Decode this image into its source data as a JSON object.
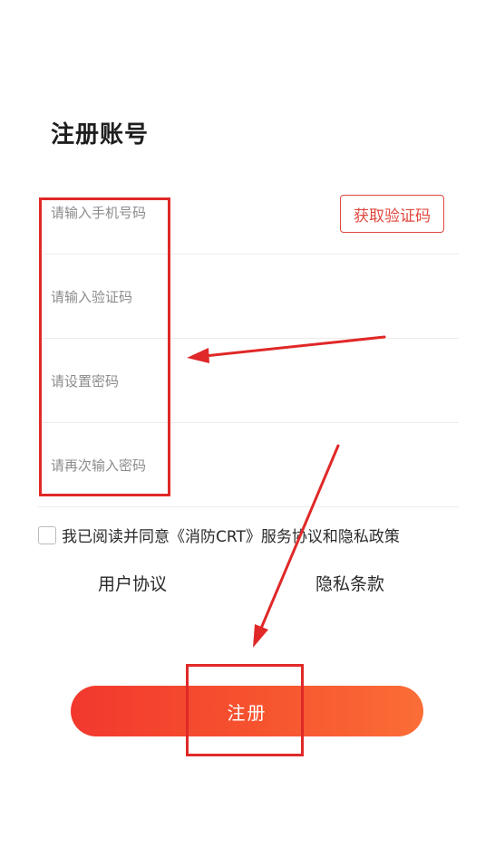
{
  "title": "注册账号",
  "form": {
    "phone_placeholder": "请输入手机号码",
    "get_code_label": "获取验证码",
    "code_placeholder": "请输入验证码",
    "password_placeholder": "请设置密码",
    "confirm_password_placeholder": "请再次输入密码"
  },
  "agreement": {
    "text": "我已阅读并同意《消防CRT》服务协议和隐私政策",
    "user_agreement_label": "用户协议",
    "privacy_label": "隐私条款"
  },
  "register_label": "注册",
  "colors": {
    "accent": "#e0483d",
    "annotation": "#e02828",
    "button_gradient_start": "#f2382e",
    "button_gradient_end": "#fb6d36"
  }
}
